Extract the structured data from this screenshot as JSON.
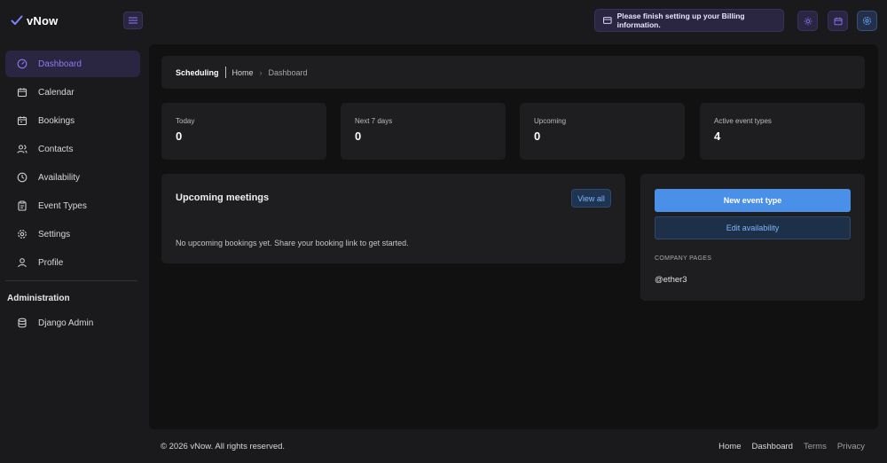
{
  "brand": {
    "name": "vNow",
    "accent": "#8b7cf6"
  },
  "sidebar": {
    "items": [
      {
        "label": "Dashboard",
        "icon": "dashboard-icon",
        "active": true
      },
      {
        "label": "Calendar",
        "icon": "calendar-icon"
      },
      {
        "label": "Bookings",
        "icon": "bookings-icon"
      },
      {
        "label": "Contacts",
        "icon": "contacts-icon"
      },
      {
        "label": "Availability",
        "icon": "clock-icon"
      },
      {
        "label": "Event Types",
        "icon": "clipboard-icon"
      },
      {
        "label": "Settings",
        "icon": "gear-icon"
      },
      {
        "label": "Profile",
        "icon": "user-icon"
      }
    ],
    "section_title": "Administration",
    "admin_items": [
      {
        "label": "Django Admin",
        "icon": "database-icon"
      }
    ]
  },
  "topbar": {
    "billing_message": "Please finish setting up your Billing information.",
    "buttons": [
      "sun-icon",
      "calendar-icon",
      "gear-icon"
    ]
  },
  "breadcrumb": {
    "title": "Scheduling",
    "home": "Home",
    "current": "Dashboard"
  },
  "stats": [
    {
      "label": "Today",
      "value": "0"
    },
    {
      "label": "Next 7 days",
      "value": "0"
    },
    {
      "label": "Upcoming",
      "value": "0"
    },
    {
      "label": "Active event types",
      "value": "4"
    }
  ],
  "meetings": {
    "title": "Upcoming meetings",
    "view_all": "View all",
    "empty_text": "No upcoming bookings yet. Share your booking link to get started."
  },
  "actions": {
    "new_event": "New event type",
    "edit_availability": "Edit availability",
    "company_pages_label": "COMPANY PAGES",
    "company_handle": "@ether3"
  },
  "footer": {
    "copyright": "© 2026 vNow. All rights reserved.",
    "links": [
      "Home",
      "Dashboard",
      "Terms",
      "Privacy"
    ]
  }
}
